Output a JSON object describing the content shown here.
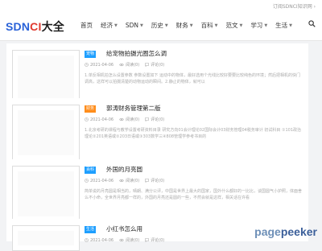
{
  "topbar": {
    "login_text": "订阅SDNCI知识网 ›"
  },
  "logo": {
    "part_a": "SDN",
    "part_b": "CI",
    "part_c": "大全"
  },
  "nav": [
    {
      "label": "首页",
      "has_dropdown": false
    },
    {
      "label": "经济",
      "has_dropdown": true
    },
    {
      "label": "SDN",
      "has_dropdown": true
    },
    {
      "label": "历史",
      "has_dropdown": true
    },
    {
      "label": "财务",
      "has_dropdown": true
    },
    {
      "label": "百科",
      "has_dropdown": true
    },
    {
      "label": "范文",
      "has_dropdown": true
    },
    {
      "label": "学习",
      "has_dropdown": true
    },
    {
      "label": "生活",
      "has_dropdown": true
    }
  ],
  "articles": [
    {
      "tag": "宠物",
      "tag_color": "#1e9fff",
      "title": "给宠物拍摄光圈怎么调",
      "date": "2021-04-06",
      "views": "阅读(0)",
      "comments": "评论(0)",
      "excerpt": "1.单反相机拍怎么设置参数 参数设置如下 运动中的物体，最好选用个光线比较好要要比较纯色的环境；然后把相机的快门调高，这样可以拍摄清楚的动物运动的瞬间。2.静止的物体，就可以"
    },
    {
      "tag": "财务",
      "tag_color": "#ff8d1b",
      "title": "郭涛财务管理第二版",
      "date": "2021-04-06",
      "views": "阅读(0)",
      "comments": "评论(0)",
      "excerpt": "1.北京考研的课程与教学设置考研资料目录 研究方向01会计理论02国际会计03财务管理04税务审计 初试科目 ①101政治理论②201英语或②203日语或③303数学三④808管理学参考书目的"
    },
    {
      "tag": "百科",
      "tag_color": "#1e9fff",
      "title": "外国的月亮圆",
      "date": "2021-04-06",
      "views": "阅读(0)",
      "comments": "评论(0)",
      "excerpt": "简单说的月亮圆是相当的，晴朗、满分公评，中国是世界上最大的国家，国外什么都好的一比比，谈国圆气小护照，体面舍么不小命，全世界月亮都一样的，外国的月亮还是圆的一些，不然会就是这样，相关话在许看"
    },
    {
      "tag": "生活",
      "tag_color": "#1e9fff",
      "title": "小红书怎么用",
      "date": "2021-04-06",
      "views": "阅读(0)",
      "comments": "评论(0)",
      "excerpt": ""
    }
  ],
  "watermark": {
    "part1": "page",
    "part2": "peeker"
  }
}
